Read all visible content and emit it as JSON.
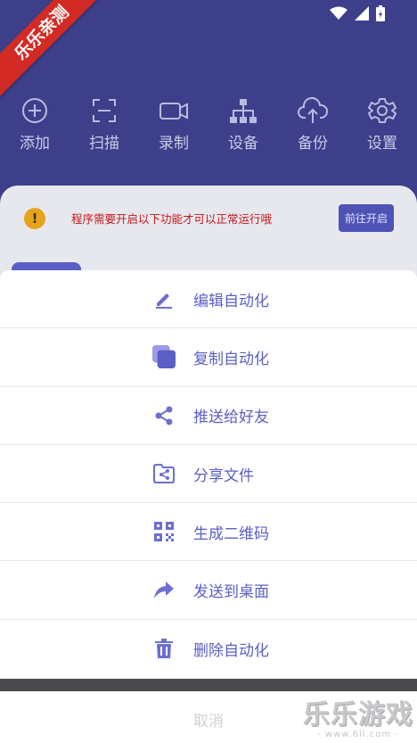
{
  "ribbon": "乐乐亲测",
  "toolbar": [
    {
      "label": "添加",
      "icon": "add-circle-icon"
    },
    {
      "label": "扫描",
      "icon": "scan-icon"
    },
    {
      "label": "录制",
      "icon": "video-camera-icon"
    },
    {
      "label": "设备",
      "icon": "network-icon"
    },
    {
      "label": "备份",
      "icon": "cloud-upload-icon"
    },
    {
      "label": "设置",
      "icon": "gear-icon"
    }
  ],
  "notice": {
    "message": "程序需要开启以下功能才可以正常运行哦",
    "action": "前往开启"
  },
  "sheet": {
    "items": [
      {
        "label": "编辑自动化",
        "icon": "edit-icon"
      },
      {
        "label": "复制自动化",
        "icon": "copy-icon"
      },
      {
        "label": "推送给好友",
        "icon": "share-icon"
      },
      {
        "label": "分享文件",
        "icon": "share-file-icon"
      },
      {
        "label": "生成二维码",
        "icon": "qr-code-icon"
      },
      {
        "label": "发送到桌面",
        "icon": "forward-icon"
      },
      {
        "label": "删除自动化",
        "icon": "delete-icon"
      }
    ],
    "cancel": "取消"
  },
  "watermark": {
    "title": "乐乐游戏",
    "url": "- www.6ll.com -"
  },
  "colors": {
    "primary": "#3d3f8a",
    "accent": "#5b5fc4",
    "warning": "#e6a41d",
    "danger": "#c21a1a"
  }
}
